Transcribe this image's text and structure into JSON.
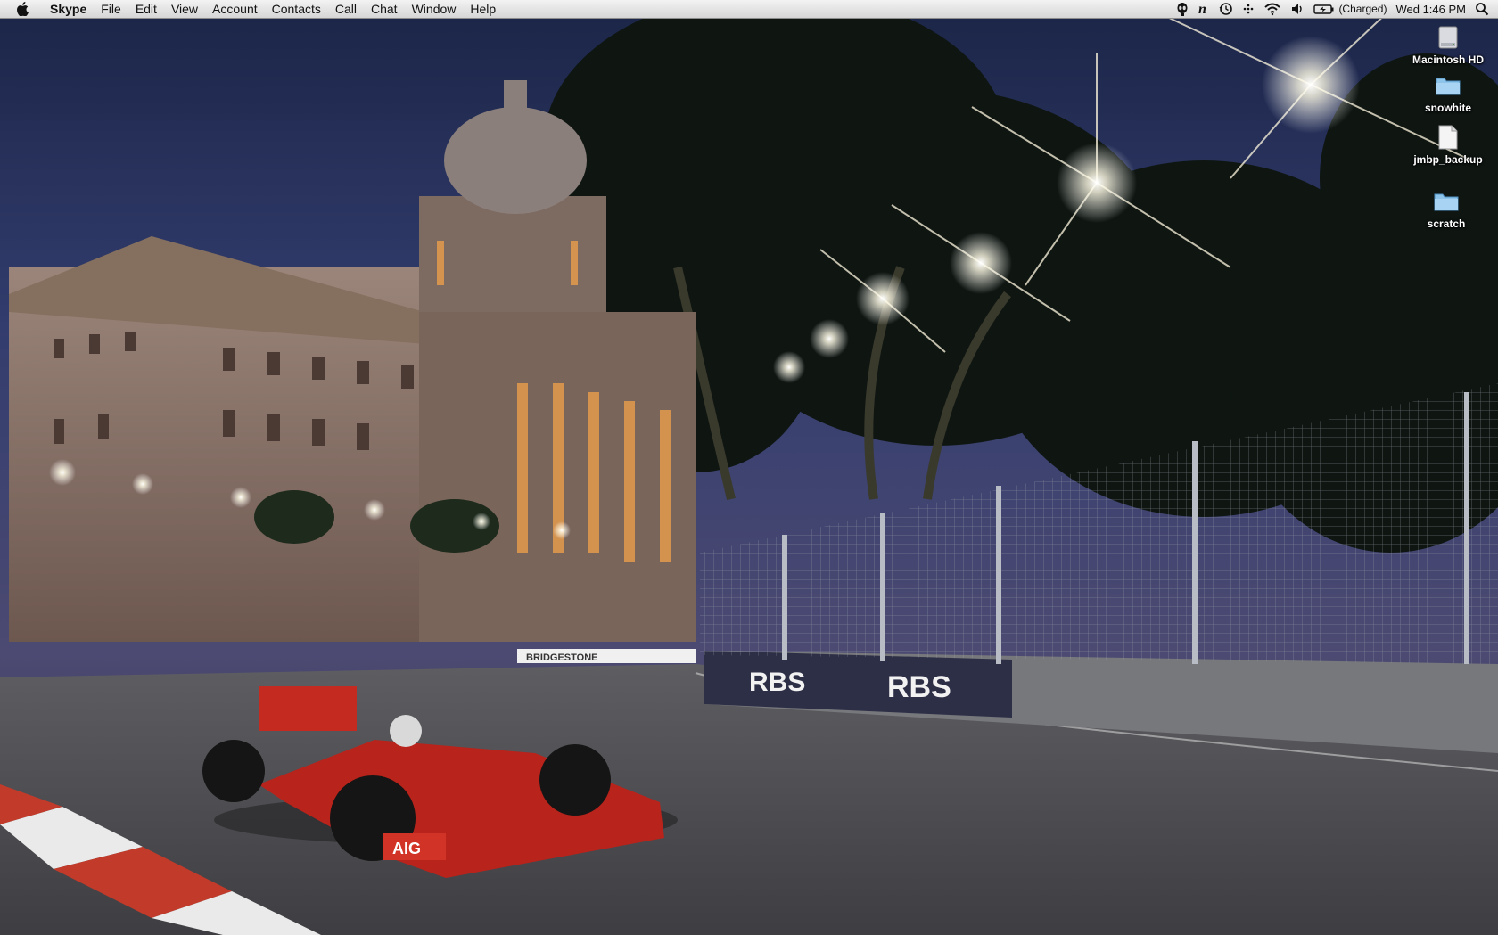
{
  "menubar": {
    "app_name": "Skype",
    "menus": [
      "File",
      "Edit",
      "View",
      "Account",
      "Contacts",
      "Call",
      "Chat",
      "Window",
      "Help"
    ],
    "status": {
      "battery_text": "(Charged)",
      "clock": "Wed 1:46 PM"
    }
  },
  "desktop": {
    "icons": [
      {
        "label": "Macintosh HD",
        "icon": "hard-drive-icon"
      },
      {
        "label": "snowhite",
        "icon": "folder-icon"
      },
      {
        "label": "jmbp_backup",
        "icon": "document-icon"
      },
      {
        "label": "scratch",
        "icon": "folder-icon"
      }
    ]
  },
  "wallpaper": {
    "barrier_text": "RBS",
    "sign_text": "BRIDGESTONE",
    "car_text": "AIG"
  }
}
